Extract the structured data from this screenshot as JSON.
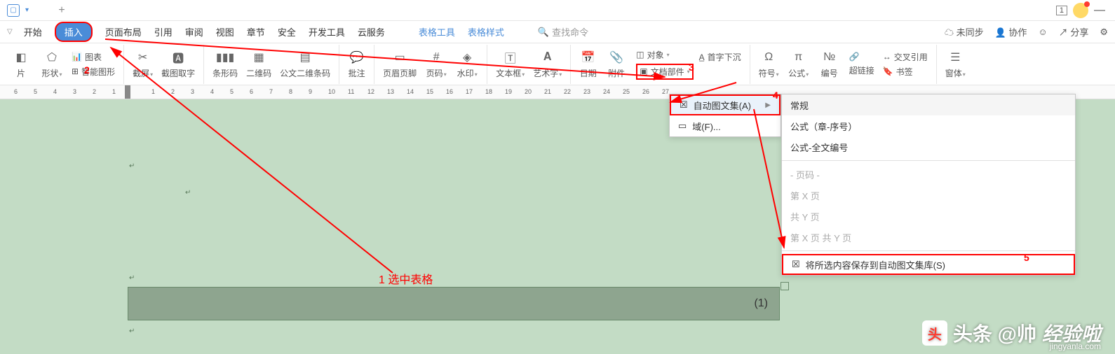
{
  "titlebar": {
    "badge": "1",
    "min": "—"
  },
  "menubar": {
    "items": [
      "开始",
      "插入",
      "页面布局",
      "引用",
      "审阅",
      "视图",
      "章节",
      "安全",
      "开发工具",
      "云服务"
    ],
    "extra": [
      "表格工具",
      "表格样式"
    ],
    "search_placeholder": "查找命令",
    "right": {
      "sync": "未同步",
      "collab": "协作",
      "share": "分享"
    }
  },
  "ribbon": {
    "r1a": "图表",
    "g": [
      {
        "label": "片"
      },
      {
        "label": "形状"
      },
      {
        "label": "智能图形"
      },
      {
        "label": "截屏"
      },
      {
        "label": "截图取字"
      },
      {
        "label": "条形码"
      },
      {
        "label": "二维码"
      },
      {
        "label": "公文二维条码"
      },
      {
        "label": "批注"
      },
      {
        "label": "页眉页脚"
      },
      {
        "label": "页码"
      },
      {
        "label": "水印"
      },
      {
        "label": "文本框"
      },
      {
        "label": "艺术字"
      },
      {
        "label": "日期"
      },
      {
        "label": "附件"
      }
    ],
    "stack1": {
      "a": "对象",
      "b": "文档部件"
    },
    "stack1b": "首字下沉",
    "g2": [
      {
        "label": "符号"
      },
      {
        "label": "公式"
      },
      {
        "label": "编号"
      }
    ],
    "stack2": {
      "a": "交叉引用",
      "b": "书签"
    },
    "hyperlink": "超链接",
    "g3": {
      "label": "窗体"
    }
  },
  "dropdown1": {
    "auto": "自动图文集(A)",
    "field": "域(F)..."
  },
  "dropdown2": {
    "header": "常规",
    "items": [
      "公式（章-序号）",
      "公式-全文编号",
      "- 页码 -",
      "第 X 页",
      "共 Y 页",
      "第 X 页 共 Y 页",
      "将所选内容保存到自动图文集库(S)"
    ]
  },
  "annotations": {
    "step1": "1  选中表格",
    "n2": "2",
    "n3": "3",
    "n4": "4",
    "n5": "5"
  },
  "table": {
    "cell": "(1)"
  },
  "ruler_marks": [
    "6",
    "5",
    "4",
    "3",
    "2",
    "1",
    "",
    "1",
    "2",
    "3",
    "4",
    "5",
    "6",
    "7",
    "8",
    "9",
    "10",
    "11",
    "12",
    "13",
    "14",
    "15",
    "16",
    "17",
    "18",
    "19",
    "20",
    "21",
    "22",
    "23",
    "24",
    "25",
    "26",
    "27"
  ],
  "watermark": {
    "main": "头条 @帅",
    "sub": "jingyanla.com",
    "extra": "经验啦"
  }
}
